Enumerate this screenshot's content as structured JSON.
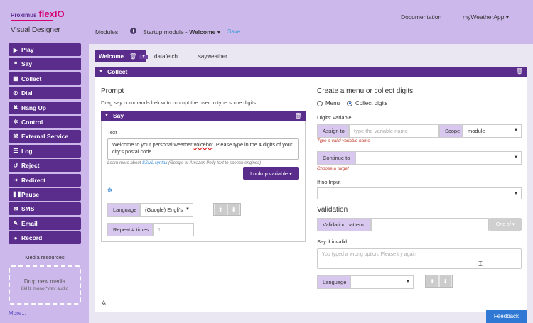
{
  "brand": {
    "prefix": "Proximus",
    "name": "flexIO"
  },
  "app_title": "Visual Designer",
  "sidebar": {
    "items": [
      {
        "icon": "play-icon",
        "glyph": "▶",
        "label": "Play"
      },
      {
        "icon": "quote-icon",
        "glyph": "❝",
        "label": "Say"
      },
      {
        "icon": "grid-icon",
        "glyph": "▦",
        "label": "Collect"
      },
      {
        "icon": "phone-icon",
        "glyph": "✆",
        "label": "Dial"
      },
      {
        "icon": "close-icon",
        "glyph": "✖",
        "label": "Hang Up"
      },
      {
        "icon": "gear-icon",
        "glyph": "✲",
        "label": "Control"
      },
      {
        "icon": "code-icon",
        "glyph": "⌘",
        "label": "External Service"
      },
      {
        "icon": "list-icon",
        "glyph": "☰",
        "label": "Log"
      },
      {
        "icon": "reject-icon",
        "glyph": "↺",
        "label": "Reject"
      },
      {
        "icon": "redirect-icon",
        "glyph": "➜",
        "label": "Redirect"
      },
      {
        "icon": "pause-icon",
        "glyph": "❚❚",
        "label": "Pause"
      },
      {
        "icon": "envelope-icon",
        "glyph": "✉",
        "label": "SMS"
      },
      {
        "icon": "comment-icon",
        "glyph": "✎",
        "label": "Email"
      },
      {
        "icon": "microphone-icon",
        "glyph": "●",
        "label": "Record"
      }
    ],
    "media_title": "Media resources",
    "drop_title": "Drop new media",
    "drop_hint": "8kHz mono *wav audio",
    "more_link": "More..."
  },
  "header": {
    "documentation": "Documentation",
    "app_menu": "myWeatherApp ▾",
    "modules": "Modules",
    "startup_prefix": "Startup module - ",
    "startup_name": "Welcome",
    "startup_caret": " ▾",
    "save": "Save"
  },
  "tabs": [
    {
      "label": "Welcome",
      "active": true
    },
    {
      "label": "datafetch",
      "active": false
    },
    {
      "label": "sayweather",
      "active": false
    }
  ],
  "collect_panel": {
    "title": "Collect"
  },
  "prompt": {
    "heading": "Prompt",
    "subtext": "Drag say commands below to prompt the user to type some digits",
    "say": {
      "title": "Say",
      "text_label": "Text",
      "text_value_a": "Welcome to your personal weather ",
      "text_value_misspelt": "voicebot",
      "text_value_b": ". Please type in the 4 digits of your city's postal code",
      "learn_prefix": "Learn more about ",
      "learn_link": "SSML syntax",
      "learn_suffix": " (Google or Amazon Polly text to speech engines)",
      "lookup_button": "Lookup variable ▾",
      "language_label": "Language",
      "language_value": "(Google) Engli's",
      "repeat_label": "Repeat # times",
      "repeat_value": "1"
    }
  },
  "menu": {
    "heading": "Create a menu or collect digits",
    "radio_menu": "Menu",
    "radio_collect": "Collect digits",
    "selected": "Collect digits",
    "digits_label": "Digits' variable",
    "assign_label": "Assign to",
    "assign_placeholder": "type the variable name",
    "scope_label": "Scope",
    "scope_value": "module",
    "assign_error": "Type a valid variable name",
    "continue_label": "Continue to",
    "continue_error": "Choose a target",
    "if_no_input_label": "If no Input",
    "validation_heading": "Validation",
    "validation_pattern_label": "Validation pattern",
    "one_of_button": "One of ▾",
    "say_if_invalid_label": "Say if invalid",
    "say_if_invalid_placeholder": "You typed a wrong option. Please try again",
    "language_label": "Language"
  },
  "feedback": "Feedback"
}
